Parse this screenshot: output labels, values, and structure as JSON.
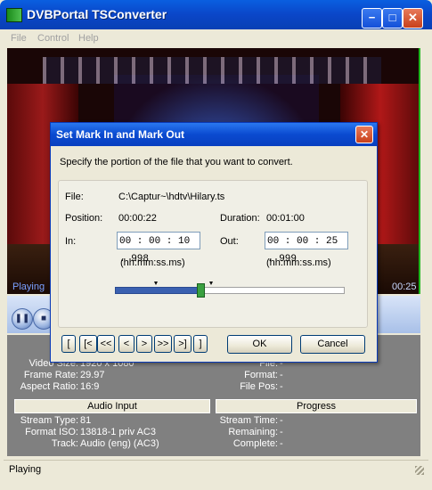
{
  "window": {
    "title": "DVBPortal TSConverter",
    "minimize": "−",
    "maximize": "□",
    "close": "✕"
  },
  "menu": [
    "File",
    "Control",
    "Help"
  ],
  "video": {
    "status": "Playing",
    "time": "00:25"
  },
  "info": {
    "video_rows": [
      {
        "label": "Video Size:",
        "value": "1920 x 1080"
      },
      {
        "label": "Frame Rate:",
        "value": "29.97"
      },
      {
        "label": "Aspect Ratio:",
        "value": "16:9"
      }
    ],
    "file_rows": [
      {
        "label": "File:",
        "value": "-"
      },
      {
        "label": "Format:",
        "value": "-"
      },
      {
        "label": "File Pos:",
        "value": "-"
      }
    ],
    "audio_header": "Audio Input",
    "audio_rows": [
      {
        "label": "Stream Type:",
        "value": "81"
      },
      {
        "label": "Format ISO:",
        "value": "13818-1 priv AC3"
      },
      {
        "label": "Track:",
        "value": "Audio (eng) (AC3)"
      }
    ],
    "progress_header": "Progress",
    "progress_rows": [
      {
        "label": "Stream Time:",
        "value": "-"
      },
      {
        "label": "Remaining:",
        "value": "-"
      },
      {
        "label": "Complete:",
        "value": "-"
      }
    ]
  },
  "status_bar": "Playing",
  "dialog": {
    "title": "Set Mark In and Mark Out",
    "close": "✕",
    "description": "Specify the portion of the file that you want to convert.",
    "file_label": "File:",
    "file_value": "C:\\Captur~\\hdtv\\Hilary.ts",
    "position_label": "Position:",
    "position_value": "00:00:22",
    "duration_label": "Duration:",
    "duration_value": "00:01:00",
    "in_label": "In:",
    "in_value": "00 : 00 : 10 . 998",
    "out_label": "Out:",
    "out_value": "00 : 00 : 25 . 999",
    "format_hint_in": "(hh:mm:ss.ms)",
    "format_hint_out": "(hh:mm:ss.ms)",
    "slider_position_fraction": 0.37,
    "nav_buttons": [
      "[",
      "[<",
      "<<",
      "<",
      ">",
      ">>",
      ">]",
      "]"
    ],
    "ok_label": "OK",
    "cancel_label": "Cancel"
  }
}
